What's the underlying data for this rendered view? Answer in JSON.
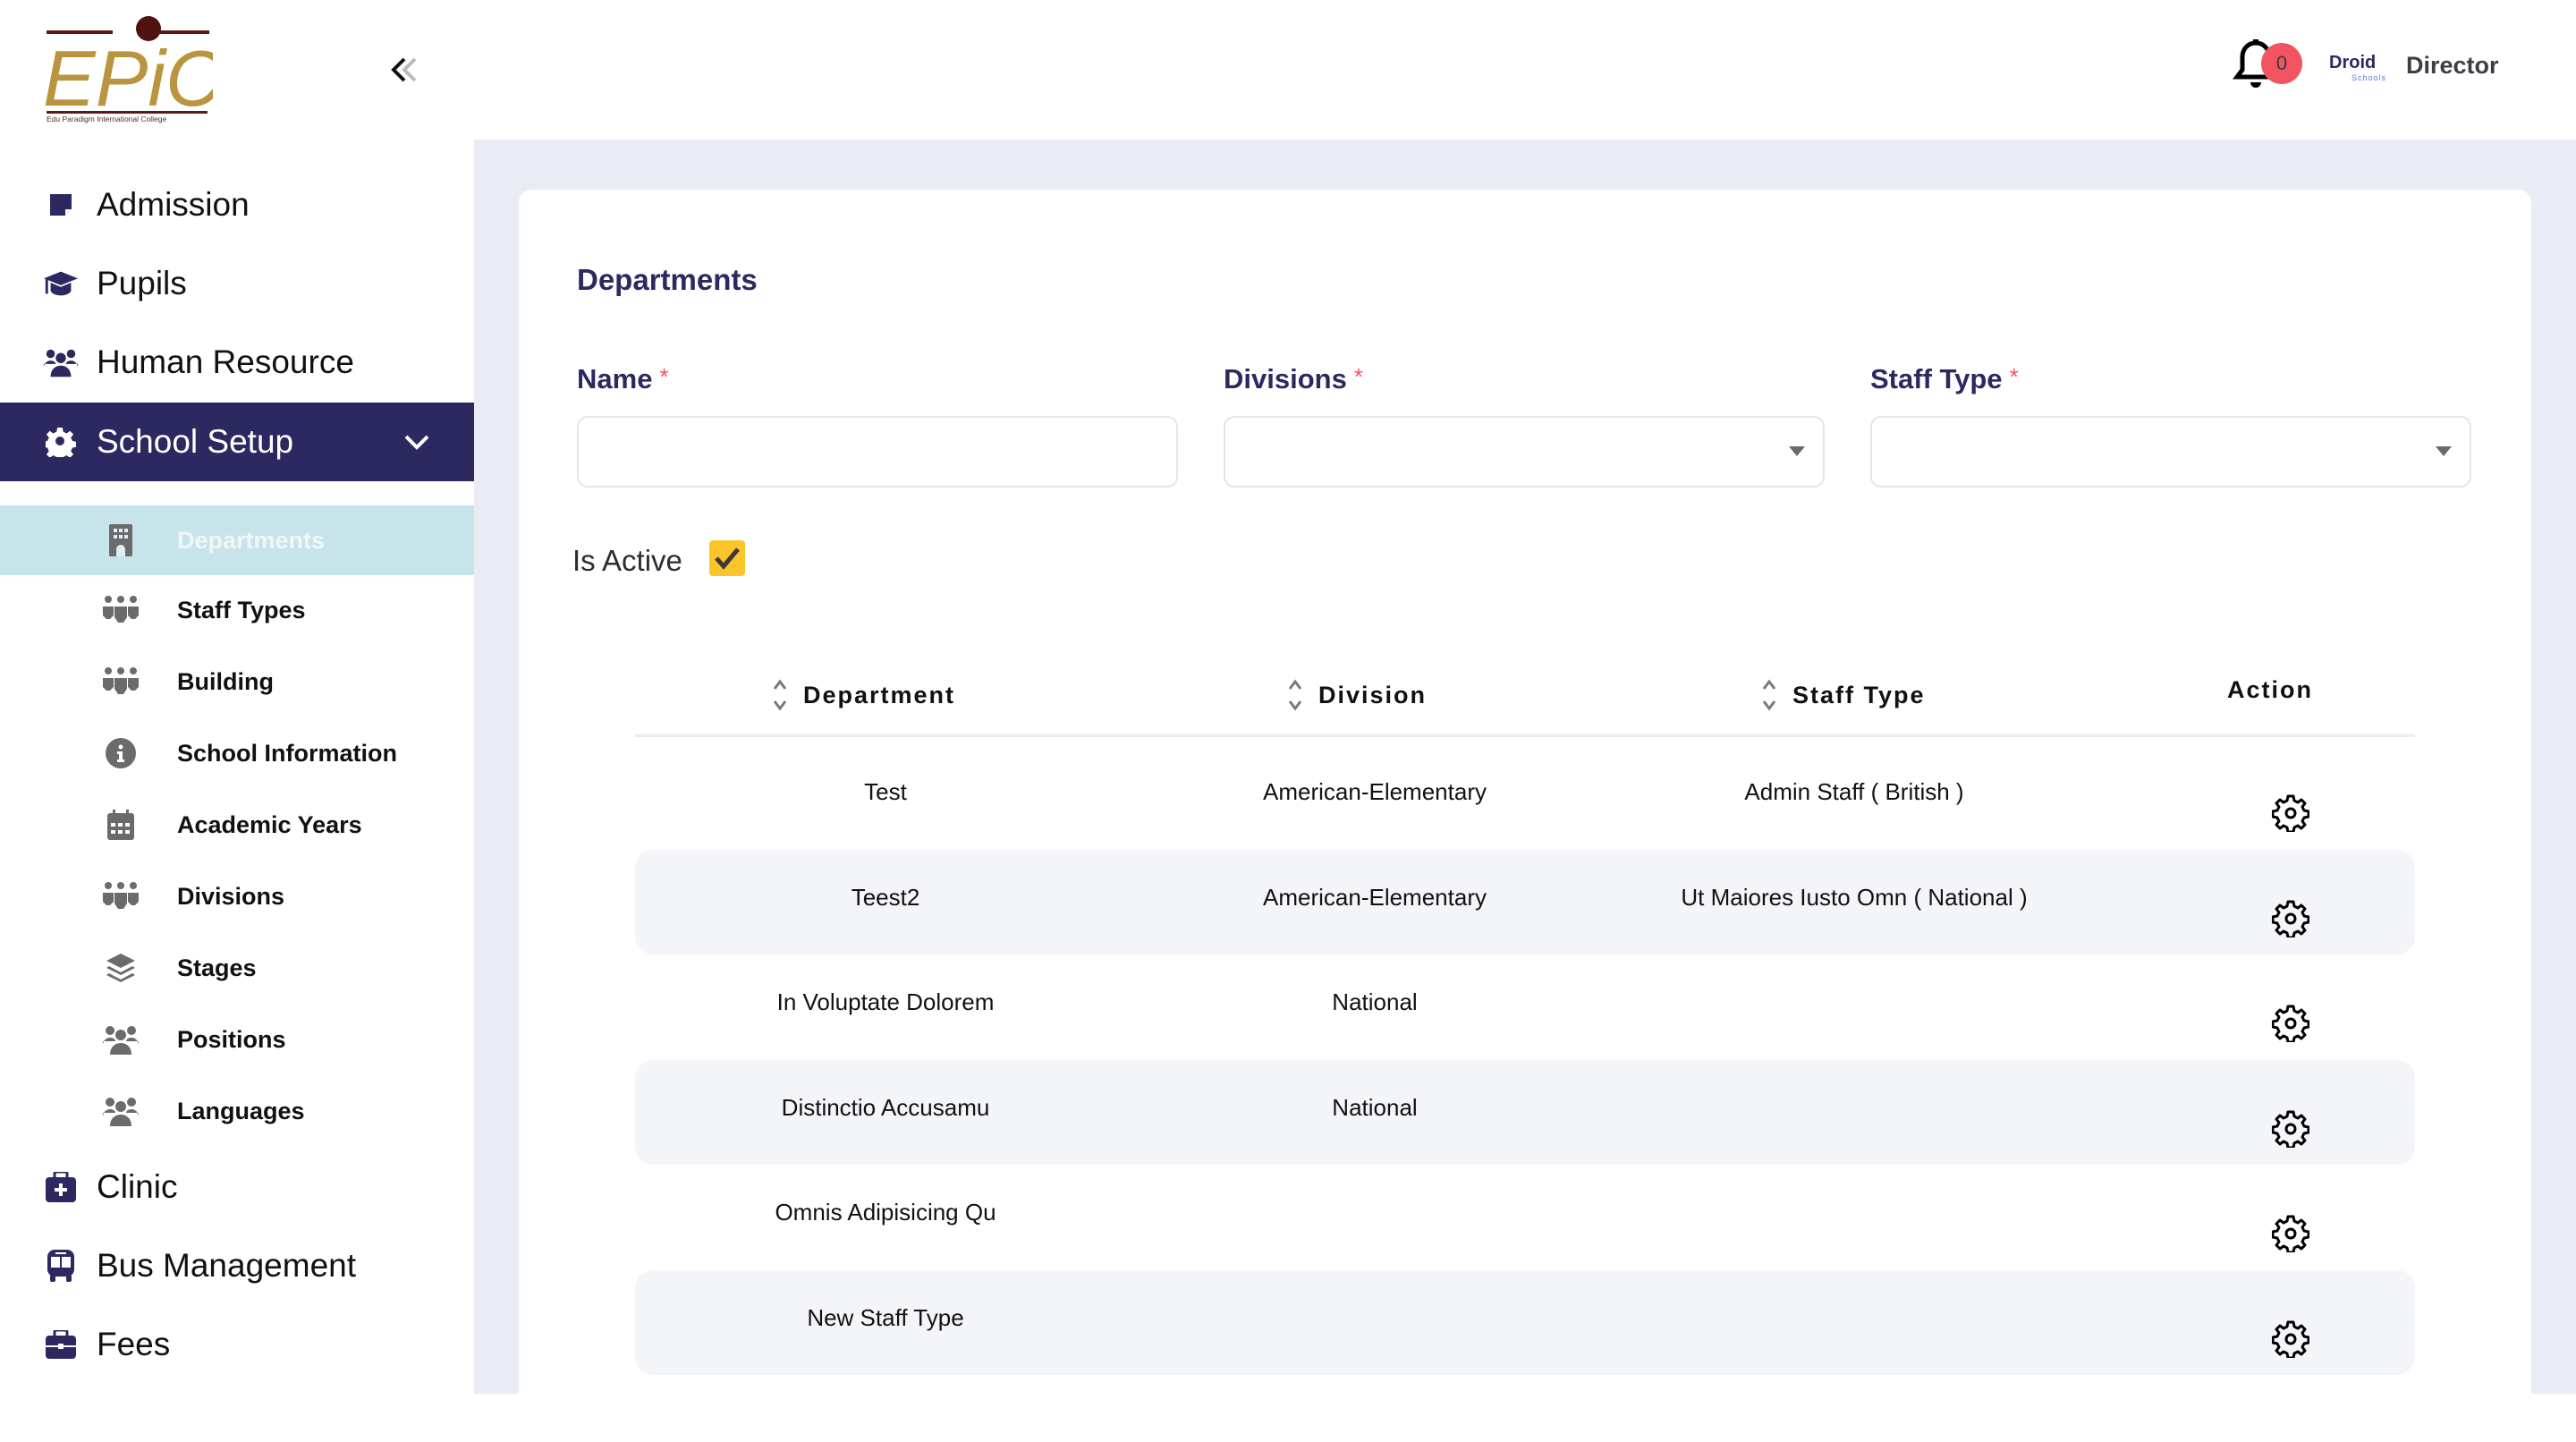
{
  "brand": {
    "logo_text": "EPiC",
    "logo_tagline": "Edu Paradigm International College",
    "partner_logo_main": "Droid",
    "partner_logo_sub": "Schools"
  },
  "header": {
    "notification_count": "0",
    "user_role": "Director"
  },
  "sidebar": {
    "collapse_icon": "double-chevron-left-icon",
    "items": [
      {
        "label": "Admission",
        "icon": "note-sticky-icon",
        "active": false
      },
      {
        "label": "Pupils",
        "icon": "graduation-cap-icon",
        "active": false
      },
      {
        "label": "Human Resource",
        "icon": "users-icon",
        "active": false
      },
      {
        "label": "School Setup",
        "icon": "gear-icon",
        "active": true,
        "expanded": true
      },
      {
        "label": "Clinic",
        "icon": "medical-kit-icon",
        "active": false
      },
      {
        "label": "Bus Management",
        "icon": "bus-icon",
        "active": false
      },
      {
        "label": "Fees",
        "icon": "briefcase-icon",
        "active": false
      }
    ],
    "sub_items": [
      {
        "label": "Departments",
        "icon": "building-icon",
        "active": true
      },
      {
        "label": "Staff Types",
        "icon": "people-group-icon"
      },
      {
        "label": "Building",
        "icon": "people-group-icon"
      },
      {
        "label": "School Information",
        "icon": "info-circle-icon"
      },
      {
        "label": "Academic Years",
        "icon": "calendar-icon"
      },
      {
        "label": "Divisions",
        "icon": "people-group-icon"
      },
      {
        "label": "Stages",
        "icon": "layers-icon"
      },
      {
        "label": "Positions",
        "icon": "users-icon"
      },
      {
        "label": "Languages",
        "icon": "users-icon"
      }
    ]
  },
  "colors": {
    "primary": "#2b2960",
    "active_sub_bg": "#c7e4ea",
    "required": "#f25461",
    "checkbox": "#fcc52a",
    "badge": "#f25461",
    "page_bg": "#eaecf5",
    "stripe": "#f4f5f9"
  },
  "form": {
    "title": "Departments",
    "name_label": "Name",
    "name_value": "",
    "divisions_label": "Divisions",
    "divisions_value": "",
    "staff_type_label": "Staff Type",
    "staff_type_value": "",
    "required_mark": "*",
    "is_active_label": "Is Active",
    "is_active": true
  },
  "table": {
    "columns": [
      {
        "label": "Department",
        "sortable": true
      },
      {
        "label": "Division",
        "sortable": true
      },
      {
        "label": "Staff Type",
        "sortable": true
      },
      {
        "label": "Action",
        "sortable": false
      }
    ],
    "rows": [
      {
        "department": "Test",
        "division": "American-Elementary",
        "staff_type": "Admin Staff ( British )"
      },
      {
        "department": "Teest2",
        "division": "American-Elementary",
        "staff_type": "Ut Maiores Iusto Omn ( National )"
      },
      {
        "department": "In Voluptate Dolorem",
        "division": "National",
        "staff_type": ""
      },
      {
        "department": "Distinctio Accusamu",
        "division": "National",
        "staff_type": ""
      },
      {
        "department": "Omnis Adipisicing Qu",
        "division": "",
        "staff_type": ""
      },
      {
        "department": "New Staff Type",
        "division": "",
        "staff_type": ""
      }
    ]
  }
}
